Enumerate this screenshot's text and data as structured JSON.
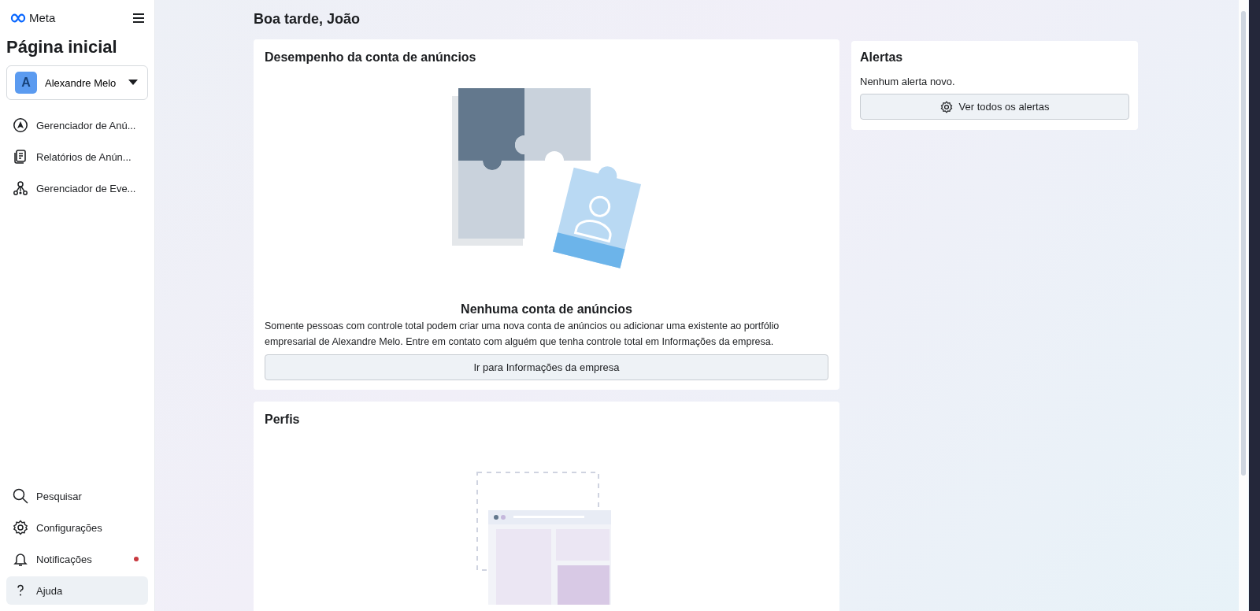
{
  "sidebar": {
    "logo": "Meta",
    "title": "Página inicial",
    "account": {
      "avatar_letter": "A",
      "name": "Alexandre Melo"
    },
    "nav_items": [
      {
        "label": "Gerenciador de Anú...",
        "selected": false
      },
      {
        "label": "Relatórios de Anún...",
        "selected": false
      },
      {
        "label": "Gerenciador de Eve...",
        "selected": false
      }
    ],
    "bottom_items": [
      {
        "label": "Pesquisar",
        "selected": false,
        "unread": false
      },
      {
        "label": "Configurações",
        "selected": false,
        "unread": false
      },
      {
        "label": "Notificações",
        "selected": false,
        "unread": true
      },
      {
        "label": "Ajuda",
        "selected": true,
        "unread": false
      }
    ]
  },
  "greeting": "Boa tarde, João",
  "ad_performance": {
    "title": "Desempenho da conta de anúncios",
    "empty_title": "Nenhuma conta de anúncios",
    "empty_text": "Somente pessoas com controle total podem criar uma nova conta de anúncios ou adicionar uma existente ao portfólio empresarial de Alexandre Melo. Entre em contato com alguém que tenha controle total em Informações da empresa.",
    "button": "Ir para Informações da empresa"
  },
  "alerts": {
    "title": "Alertas",
    "text": "Nenhum alerta novo.",
    "button": "Ver todos os alertas"
  },
  "profiles": {
    "title": "Perfis"
  }
}
